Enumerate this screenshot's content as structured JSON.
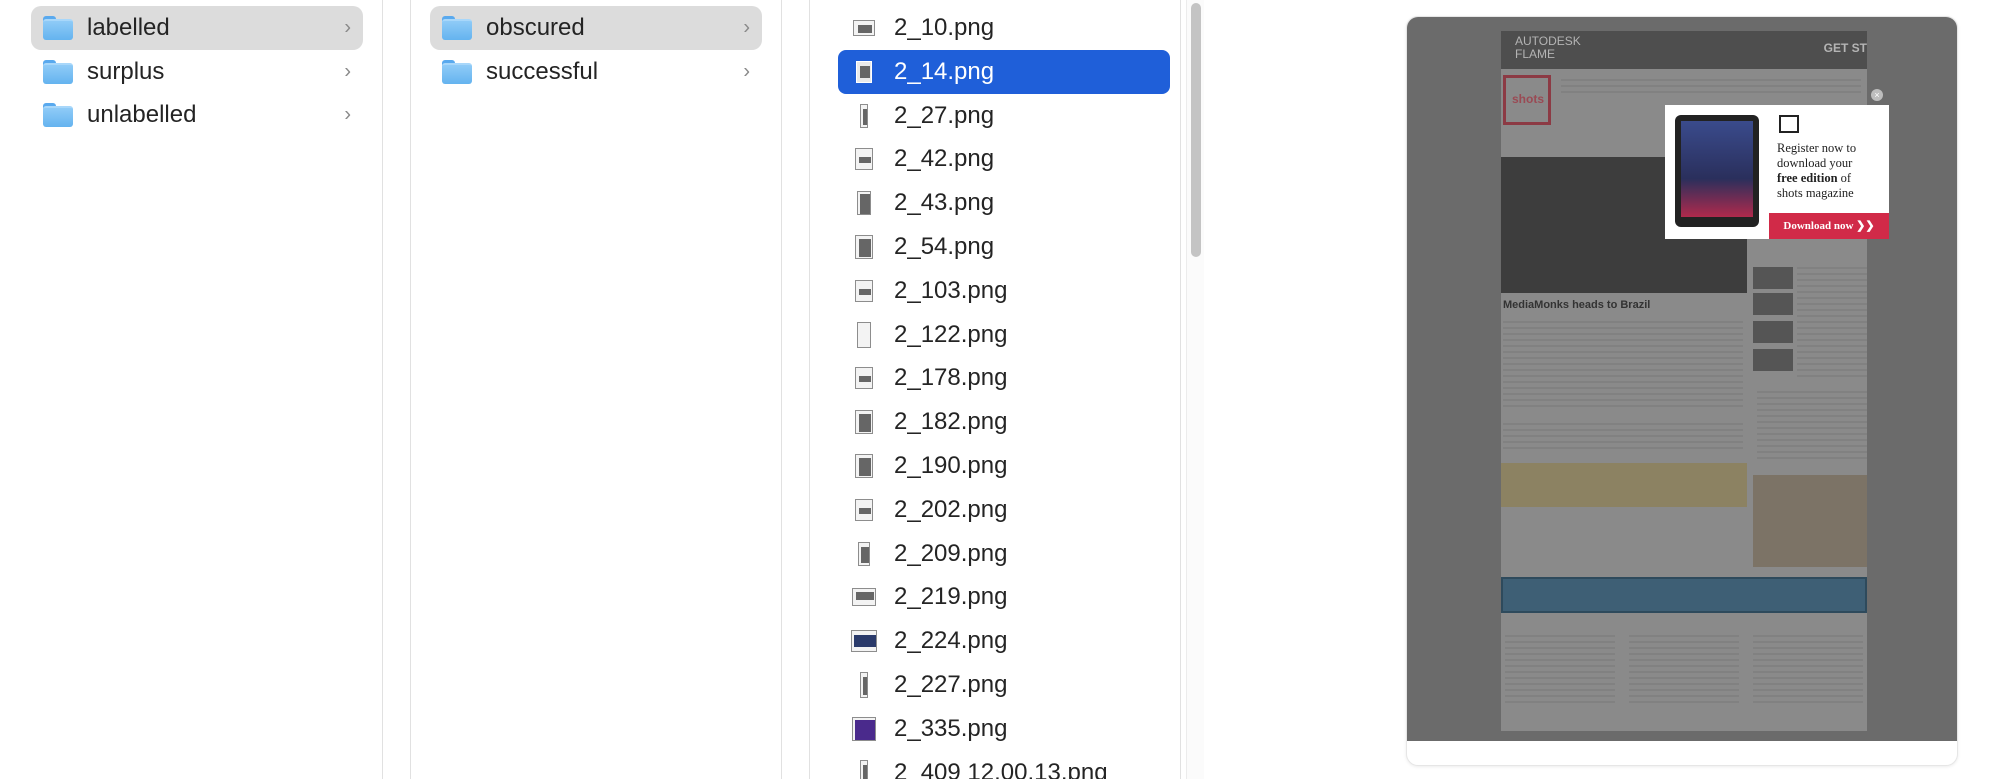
{
  "column1": {
    "items": [
      {
        "label": "labelled",
        "selected": true
      },
      {
        "label": "surplus"
      },
      {
        "label": "unlabelled"
      }
    ]
  },
  "column2": {
    "items": [
      {
        "label": "obscured",
        "selected": true
      },
      {
        "label": "successful"
      }
    ]
  },
  "column3": {
    "selected_color": "#1f5fd9",
    "files": [
      {
        "name": "2_10.png",
        "icon": "image-thumbnail-icon"
      },
      {
        "name": "2_14.png",
        "icon": "image-thumbnail-icon",
        "selected": true
      },
      {
        "name": "2_27.png",
        "icon": "image-thumbnail-icon"
      },
      {
        "name": "2_42.png",
        "icon": "image-thumbnail-icon"
      },
      {
        "name": "2_43.png",
        "icon": "image-thumbnail-icon"
      },
      {
        "name": "2_54.png",
        "icon": "image-thumbnail-icon"
      },
      {
        "name": "2_103.png",
        "icon": "image-thumbnail-icon"
      },
      {
        "name": "2_122.png",
        "icon": "image-thumbnail-icon"
      },
      {
        "name": "2_178.png",
        "icon": "image-thumbnail-icon"
      },
      {
        "name": "2_182.png",
        "icon": "image-thumbnail-icon"
      },
      {
        "name": "2_190.png",
        "icon": "image-thumbnail-icon"
      },
      {
        "name": "2_202.png",
        "icon": "image-thumbnail-icon"
      },
      {
        "name": "2_209.png",
        "icon": "image-thumbnail-icon"
      },
      {
        "name": "2_219.png",
        "icon": "image-thumbnail-icon"
      },
      {
        "name": "2_224.png",
        "icon": "image-thumbnail-icon"
      },
      {
        "name": "2_227.png",
        "icon": "image-thumbnail-icon"
      },
      {
        "name": "2_335.png",
        "icon": "image-thumbnail-icon"
      },
      {
        "name": "2_409 12.00.13.png",
        "icon": "image-thumbnail-icon"
      }
    ]
  },
  "preview": {
    "banner_brand_line1": "AUTODESK",
    "banner_brand_line2": "FLAME",
    "banner_cta": "GET ST",
    "logo_text": "shots",
    "headline": "MediaMonks heads to Brazil",
    "popup": {
      "message_line1": "Register now to",
      "message_line2": "download your",
      "message_bold": "free edition",
      "message_after_bold": " of",
      "message_line4": "shots magazine",
      "download_label": "Download now ❯❯"
    }
  }
}
